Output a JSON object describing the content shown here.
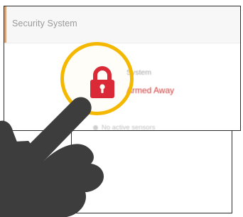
{
  "panel": {
    "title": "Security System"
  },
  "status": {
    "caption": "System",
    "value": "Armed Away"
  },
  "sensors": {
    "text": "No active sensors"
  },
  "icons": {
    "lock": "lock-icon",
    "hand": "pointing-hand-icon",
    "highlight": "highlight-circle"
  },
  "colors": {
    "accent": "#d9a57a",
    "lock": "#d9263a",
    "status_armed": "#d23a3a",
    "highlight": "#f5b800",
    "hand": "#3d3d3d"
  }
}
